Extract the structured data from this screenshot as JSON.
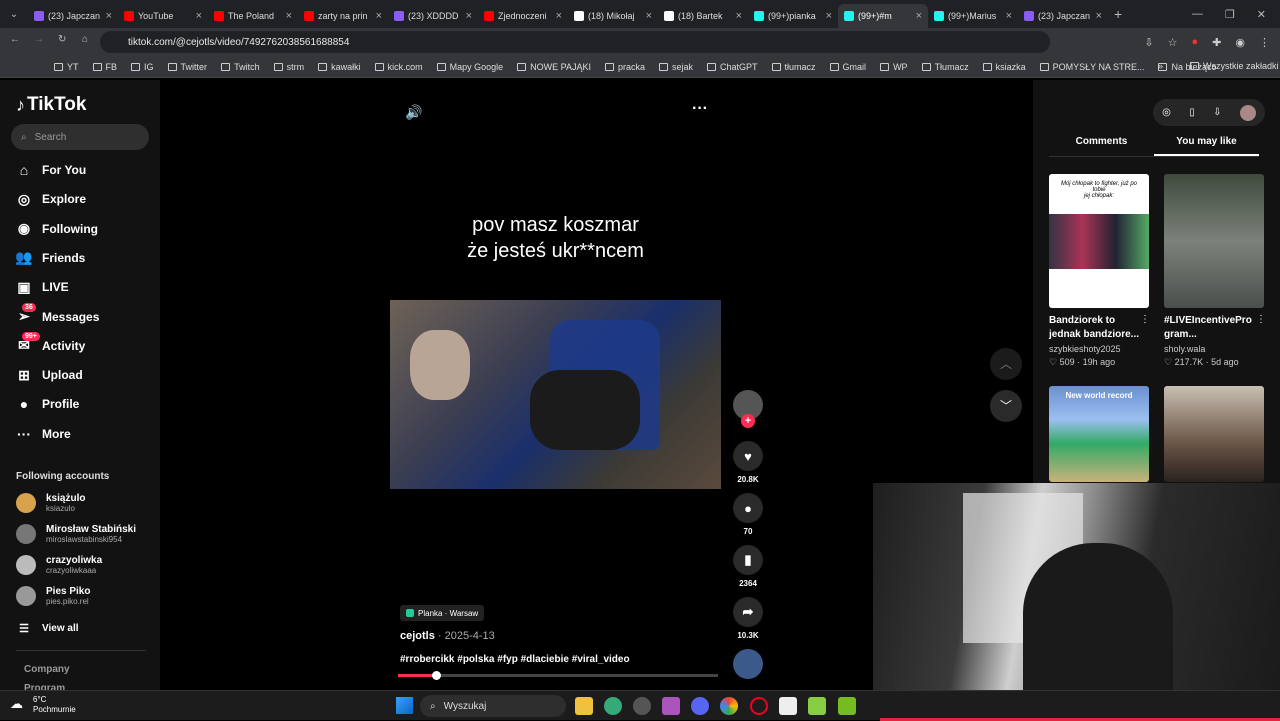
{
  "browser": {
    "tabs": [
      {
        "label": "(23) Japczan",
        "color": "#8a5cf6"
      },
      {
        "label": "YouTube",
        "color": "#ff0000"
      },
      {
        "label": "The Poland",
        "color": "#ff0000"
      },
      {
        "label": "zarty na prin",
        "color": "#ff0000"
      },
      {
        "label": "(23) XDDDD",
        "color": "#8a5cf6"
      },
      {
        "label": "Zjednoczeni",
        "color": "#ff0000"
      },
      {
        "label": "(18) Mikołaj",
        "color": "#ffffff"
      },
      {
        "label": "(18) Bartek",
        "color": "#ffffff"
      },
      {
        "label": "(99+)pianka",
        "color": "#25f4ee"
      },
      {
        "label": "(99+)#m",
        "color": "#25f4ee"
      },
      {
        "label": "(99+)Marius",
        "color": "#25f4ee"
      },
      {
        "label": "(23) Japczan",
        "color": "#8a5cf6"
      }
    ],
    "url": "tiktok.com/@cejotls/video/7492762038561688854",
    "bookmarks": [
      "YT",
      "FB",
      "IG",
      "Twitter",
      "Twitch",
      "strm",
      "kawałki",
      "kick.com",
      "Mapy Google",
      "NOWE PAJĄKI",
      "pracka",
      "sejak",
      "ChatGPT",
      "tłumacz",
      "Gmail",
      "WP",
      "Tłumacz",
      "ksiazka",
      "POMYSŁY NA STRE...",
      "Na bieżąco"
    ],
    "all_bookmarks": "Wszystkie zakładki"
  },
  "sidebar": {
    "logo": "TikTok",
    "search_placeholder": "Search",
    "nav": [
      {
        "label": "For You",
        "icon": "home-icon"
      },
      {
        "label": "Explore",
        "icon": "compass-icon"
      },
      {
        "label": "Following",
        "icon": "following-icon"
      },
      {
        "label": "Friends",
        "icon": "friends-icon"
      },
      {
        "label": "LIVE",
        "icon": "live-icon"
      },
      {
        "label": "Messages",
        "icon": "messages-icon",
        "badge": "36"
      },
      {
        "label": "Activity",
        "icon": "activity-icon",
        "badge": "99+"
      },
      {
        "label": "Upload",
        "icon": "upload-icon"
      },
      {
        "label": "Profile",
        "icon": "profile-icon"
      },
      {
        "label": "More",
        "icon": "more-icon"
      }
    ],
    "following_title": "Following accounts",
    "accounts": [
      {
        "name": "książulo",
        "handle": "ksiazulo"
      },
      {
        "name": "Mirosław Stabiński",
        "handle": "miroslawstabinski954"
      },
      {
        "name": "crazyoliwka",
        "handle": "crazyoliwkaaa"
      },
      {
        "name": "Pies Piko",
        "handle": "pies.piko.rel"
      }
    ],
    "view_all": "View all",
    "footer": [
      "Company",
      "Program"
    ]
  },
  "video": {
    "caption_line1": "pov masz koszmar",
    "caption_line2": "że jesteś ukr**ncem",
    "location": "Planka · Warsaw",
    "author": "cejotls",
    "date": "2025-4-13",
    "hashtags": "#rrobercikk #polska #fyp #dlaciebie #viral_video",
    "progress": 0.12,
    "likes": "20.8K",
    "comments": "70",
    "saves": "2364",
    "shares": "10.3K"
  },
  "right": {
    "tabs": [
      "Comments",
      "You may like"
    ],
    "active_tab": 1,
    "cards": [
      {
        "title": "Bandziorek to jednak bandziore...",
        "author": "szybkieshoty2025",
        "likes": "509",
        "age": "19h ago",
        "thumb_text": "Mój chłopak to fighter, już po tobie\njej chłopak:"
      },
      {
        "title": "#LIVEIncentivePro gram...",
        "author": "sholy.wala",
        "likes": "217.7K",
        "age": "5d ago"
      }
    ],
    "card3_text": "New world record"
  },
  "taskbar": {
    "weather_temp": "6°C",
    "weather_desc": "Pochmurnie",
    "search": "Wyszukaj"
  },
  "colors": {
    "accent": "#fe2c55",
    "bg": "#121212"
  }
}
